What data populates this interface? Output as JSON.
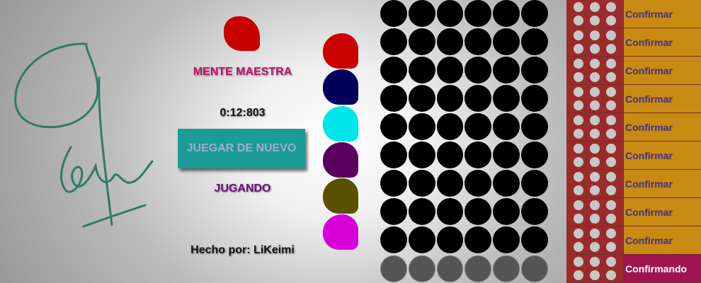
{
  "app": {
    "title": "MENTE MAESTRA",
    "timer": "0:12:803",
    "restart_label": "JUEGAR DE NUEVO",
    "status": "JUGANDO",
    "credits": "Hecho por: LiKeimi"
  },
  "colors": {
    "title": "#c0136a",
    "status": "#6a1078",
    "secret_peg": "#c80000",
    "hole_empty": "#000000",
    "hole_current": "#555555",
    "feedback_bg": "#9b2b2b",
    "confirm_bg": "#c98a12",
    "confirming_bg": "#a01452"
  },
  "secret_peg": {
    "color": "#c80000"
  },
  "palette": [
    {
      "name": "red",
      "color": "#cc0000"
    },
    {
      "name": "navy",
      "color": "#00005c"
    },
    {
      "name": "cyan",
      "color": "#00e6ea"
    },
    {
      "name": "purple",
      "color": "#5a0060"
    },
    {
      "name": "olive",
      "color": "#5a5000"
    },
    {
      "name": "magenta",
      "color": "#d800d8"
    }
  ],
  "board": {
    "rows": 10,
    "columns": 6,
    "current_row": 10
  },
  "feedback": {
    "rows": [
      {
        "label": "Confirmar"
      },
      {
        "label": "Confirmar"
      },
      {
        "label": "Confirmar"
      },
      {
        "label": "Confirmar"
      },
      {
        "label": "Confirmar"
      },
      {
        "label": "Confirmar"
      },
      {
        "label": "Confirmar"
      },
      {
        "label": "Confirmar"
      },
      {
        "label": "Confirmar"
      },
      {
        "label": "Confirmando"
      }
    ]
  }
}
